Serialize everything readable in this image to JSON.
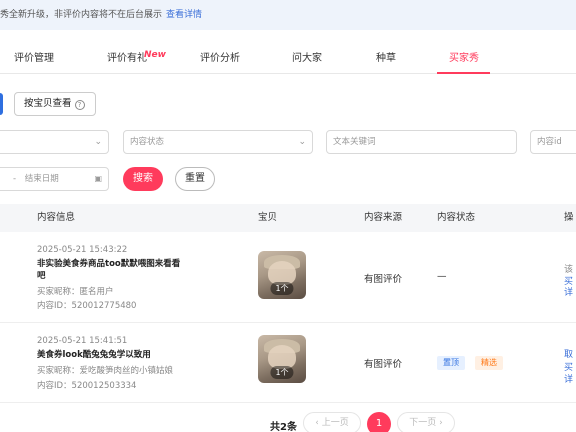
{
  "notice": {
    "text": "秀全新升级，非评价内容将不在后台展示",
    "link": "查看详情"
  },
  "tabs": [
    {
      "label": "评价管理",
      "active": false
    },
    {
      "label": "评价有礼",
      "active": false,
      "badge": "New"
    },
    {
      "label": "评价分析",
      "active": false
    },
    {
      "label": "问大家",
      "active": false
    },
    {
      "label": "种草",
      "active": false
    },
    {
      "label": "买家秀",
      "active": true
    }
  ],
  "view_toggle": {
    "label": "按宝贝查看",
    "help_icon": "question-circle-icon"
  },
  "filters": {
    "content_status_placeholder": "内容状态",
    "keyword_placeholder": "文本关键词",
    "content_id_placeholder": "内容id",
    "date_separator": "-",
    "end_date_placeholder": "结束日期"
  },
  "actions": {
    "search": "搜索",
    "reset": "重置"
  },
  "table": {
    "headers": [
      "内容信息",
      "宝贝",
      "内容来源",
      "内容状态",
      "操"
    ],
    "rows": [
      {
        "time": "2025-05-21 15:43:22",
        "title": "非实验美食券商品too默默喂图来看看吧",
        "buyer": "买家昵称：匿名用户",
        "content_id": "内容ID：520012775480",
        "item_count": "1个",
        "source": "有图评价",
        "status": "—",
        "tags": [],
        "op_lines": [
          "该",
          "买",
          "详"
        ]
      },
      {
        "time": "2025-05-21 15:41:51",
        "title": "美食券look酷兔兔兔学以致用",
        "buyer": "买家昵称：爱吃酸笋肉丝的小镇姑娘",
        "content_id": "内容ID：520012503334",
        "item_count": "1个",
        "source": "有图评价",
        "status": "",
        "tags": [
          {
            "label": "置顶",
            "color": "#2f6fe0"
          },
          {
            "label": "精选",
            "color": "#ff7a1a"
          }
        ],
        "op_lines": [
          "取",
          "买",
          "详"
        ]
      }
    ]
  },
  "pagination": {
    "total": "共2条",
    "prev": "上一页",
    "current": "1",
    "next": "下一页"
  },
  "colors": {
    "accent": "#ff3b5c",
    "link": "#3b6fd8",
    "tag_blue": "#2f6fe0",
    "tag_orange": "#ff7a1a"
  }
}
